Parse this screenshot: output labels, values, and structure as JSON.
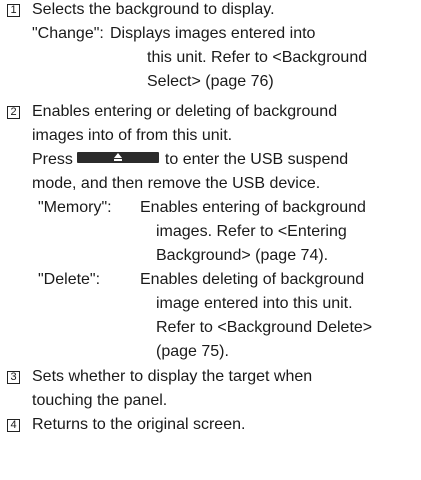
{
  "items": [
    {
      "number": "1",
      "description": "Selects the background to display.",
      "options": [
        {
          "key": "\"Change\":",
          "lines": [
            "Displays images entered into",
            "this unit. Refer to <Background",
            "Select> (page 76)"
          ]
        }
      ]
    },
    {
      "number": "2",
      "description_lines": [
        "Enables entering or deleting of background",
        "images into of from this unit."
      ],
      "press_prefix": "Press",
      "press_suffix": "to enter the USB suspend",
      "press_line2": "mode, and then remove the USB device.",
      "eject_button_icon": "eject-icon",
      "options": [
        {
          "key": "\"Memory\":",
          "lines": [
            "Enables entering of background",
            "images. Refer to <Entering",
            "Background> (page 74)."
          ]
        },
        {
          "key": "\"Delete\":",
          "lines": [
            "Enables deleting of background",
            "image entered into this unit.",
            "Refer to <Background Delete>",
            "(page 75)."
          ]
        }
      ]
    },
    {
      "number": "3",
      "description_lines": [
        "Sets whether to display the target when",
        "touching the panel."
      ]
    },
    {
      "number": "4",
      "description": "Returns to the original screen."
    }
  ]
}
